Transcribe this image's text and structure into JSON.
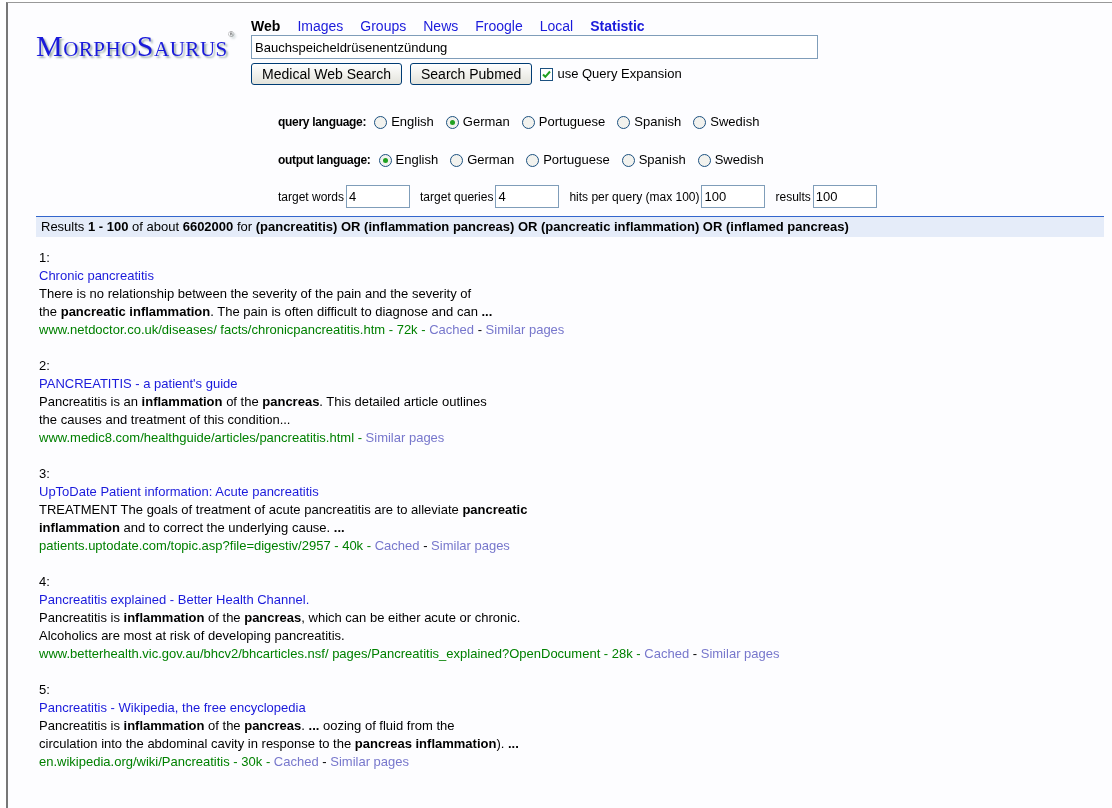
{
  "logo": {
    "text": "MorphoSaurus",
    "mark": "®"
  },
  "tabs": [
    {
      "label": "Web",
      "selected": true,
      "emphasized": true
    },
    {
      "label": "Images",
      "selected": false,
      "emphasized": false
    },
    {
      "label": "Groups",
      "selected": false,
      "emphasized": false
    },
    {
      "label": "News",
      "selected": false,
      "emphasized": false
    },
    {
      "label": "Froogle",
      "selected": false,
      "emphasized": false
    },
    {
      "label": "Local",
      "selected": false,
      "emphasized": false
    },
    {
      "label": "Statistic",
      "selected": false,
      "emphasized": true
    }
  ],
  "search": {
    "value": "Bauchspeicheldrüsenentzündung"
  },
  "buttons": [
    "Medical Web Search",
    "Search Pubmed"
  ],
  "query_expansion": {
    "label": "use Query Expansion",
    "checked": true
  },
  "language_groups": [
    {
      "label": "query language:",
      "options": [
        {
          "label": "English",
          "selected": false
        },
        {
          "label": "German",
          "selected": true
        },
        {
          "label": "Portuguese",
          "selected": false
        },
        {
          "label": "Spanish",
          "selected": false
        },
        {
          "label": "Swedish",
          "selected": false
        }
      ]
    },
    {
      "label": "output language:",
      "options": [
        {
          "label": "English",
          "selected": true
        },
        {
          "label": "German",
          "selected": false
        },
        {
          "label": "Portuguese",
          "selected": false
        },
        {
          "label": "Spanish",
          "selected": false
        },
        {
          "label": "Swedish",
          "selected": false
        }
      ]
    }
  ],
  "settings": [
    {
      "label": "target words",
      "value": "4"
    },
    {
      "label": "target queries",
      "value": "4"
    },
    {
      "label": "hits per query (max 100)",
      "value": "100"
    },
    {
      "label": "results",
      "value": "100"
    }
  ],
  "results_summary": "Results **1 - 100** of about **6602000** for **(pancreatitis) OR (inflammation pancreas) OR (pancreatic inflammation) OR (inflamed pancreas)**",
  "results": [
    {
      "number": "1:",
      "title": "Chronic pancreatitis",
      "snippet": [
        "There is no relationship between the severity of the pain and the severity of",
        "the **pancreatic inflammation**. The pain is often difficult to diagnose and can **...**"
      ],
      "url": "www.netdoctor.co.uk/diseases/ facts/chronicpancreatitis.htm - 72k -",
      "cached": "Cached",
      "separator": "-",
      "similar": "Similar pages"
    },
    {
      "number": "2:",
      "title": "PANCREATITIS - a patient's guide",
      "snippet": [
        "Pancreatitis is an **inflammation** of the **pancreas**. This detailed article outlines",
        "the causes and treatment of this condition..."
      ],
      "url": "www.medic8.com/healthguide/articles/pancreatitis.html -",
      "similar": "Similar pages"
    },
    {
      "number": "3:",
      "title": "UpToDate Patient information: Acute pancreatitis",
      "snippet": [
        "TREATMENT  The goals of treatment of acute pancreatitis are to alleviate **pancreatic**",
        "**inflammation** and to correct the underlying cause. **...**"
      ],
      "url": "patients.uptodate.com/topic.asp?file=digestiv/2957 - 40k -",
      "cached": "Cached",
      "separator": "-",
      "similar": "Similar pages"
    },
    {
      "number": "4:",
      "title": "Pancreatitis explained - Better Health Channel.",
      "snippet": [
        "Pancreatitis is **inflammation** of the **pancreas**, which can be either acute or chronic.",
        "Alcoholics are most at risk of developing pancreatitis."
      ],
      "url": "www.betterhealth.vic.gov.au/bhcv2/bhcarticles.nsf/ pages/Pancreatitis_explained?OpenDocument - 28k -",
      "cached": "Cached",
      "separator": "-",
      "similar": "Similar pages"
    },
    {
      "number": "5:",
      "title": "Pancreatitis - Wikipedia, the free encyclopedia",
      "snippet": [
        "Pancreatitis is **inflammation** of the **pancreas**. **...** oozing of fluid from the",
        "circulation into the abdominal cavity in response to the **pancreas inflammation**). **...**"
      ],
      "url": "en.wikipedia.org/wiki/Pancreatitis - 30k -",
      "cached": "Cached",
      "separator": "-",
      "similar": "Similar pages"
    }
  ]
}
